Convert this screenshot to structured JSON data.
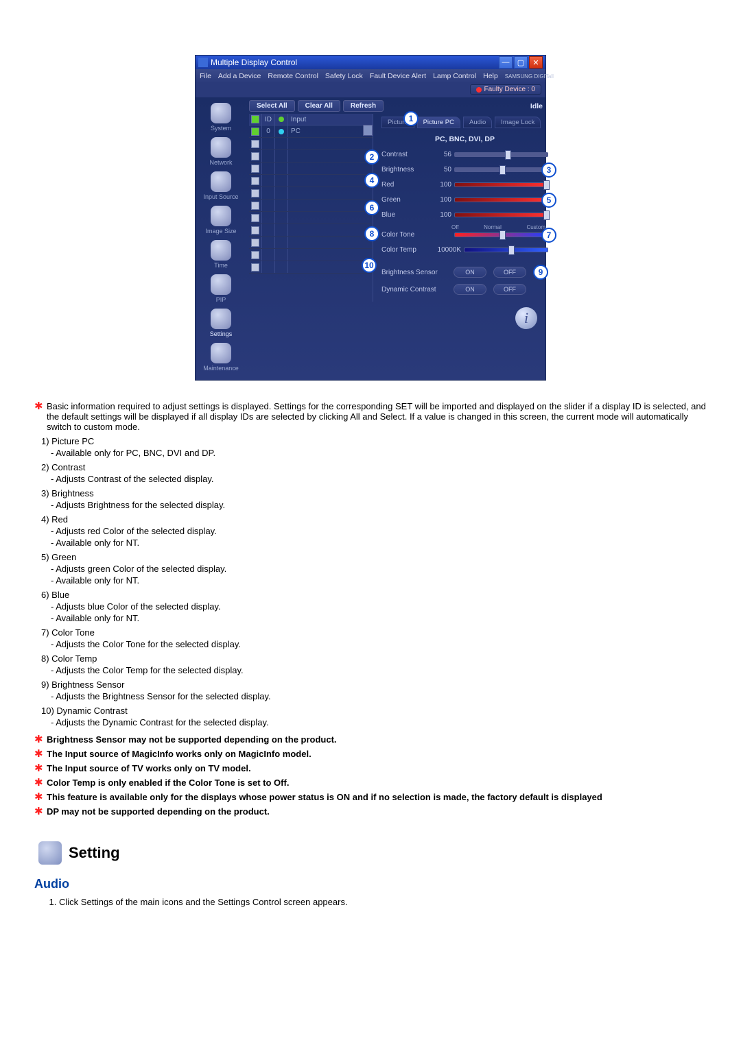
{
  "window": {
    "title": "Multiple Display Control",
    "brand": "SAMSUNG DIGITall"
  },
  "menu": {
    "file": "File",
    "add": "Add a Device",
    "remote": "Remote Control",
    "safety": "Safety Lock",
    "fault": "Fault Device Alert",
    "lamp": "Lamp Control",
    "help": "Help"
  },
  "faulty": "Faulty Device : 0",
  "buttons": {
    "select_all": "Select All",
    "clear_all": "Clear All",
    "refresh": "Refresh",
    "idle": "Idle"
  },
  "sidebar": {
    "items": [
      {
        "label": "System"
      },
      {
        "label": "Network"
      },
      {
        "label": "Input Source"
      },
      {
        "label": "Image Size"
      },
      {
        "label": "Time"
      },
      {
        "label": "PIP"
      },
      {
        "label": "Settings"
      },
      {
        "label": "Maintenance"
      }
    ]
  },
  "table": {
    "head_id": "ID",
    "head_input": "Input",
    "row": {
      "id": "0",
      "input": "PC"
    }
  },
  "tabs": {
    "picture": "Picture",
    "picture_pc": "Picture PC",
    "audio": "Audio",
    "image_lock": "Image Lock"
  },
  "panel": {
    "sub": "PC, BNC, DVI, DP",
    "contrast": {
      "label": "Contrast",
      "value": "56"
    },
    "brightness": {
      "label": "Brightness",
      "value": "50"
    },
    "red": {
      "label": "Red",
      "value": "100"
    },
    "green": {
      "label": "Green",
      "value": "100"
    },
    "blue": {
      "label": "Blue",
      "value": "100"
    },
    "color_tone": {
      "label": "Color Tone",
      "off": "Off",
      "normal": "Normal",
      "custom": "Custom"
    },
    "color_temp": {
      "label": "Color Temp",
      "value": "10000K"
    },
    "b_sensor": {
      "label": "Brightness Sensor",
      "on": "ON",
      "off": "OFF"
    },
    "d_contrast": {
      "label": "Dynamic Contrast",
      "on": "ON",
      "off": "OFF"
    }
  },
  "anno": {
    "n1": "1",
    "n2": "2",
    "n3": "3",
    "n4": "4",
    "n5": "5",
    "n6": "6",
    "n7": "7",
    "n8": "8",
    "n9": "9",
    "n10": "10"
  },
  "doc": {
    "intro": "Basic information required to adjust settings is displayed. Settings for the corresponding SET will be imported and displayed on the slider if a display ID is selected, and the default settings will be displayed if all display IDs are selected by clicking All and Select. If a value is changed in this screen, the current mode will automatically switch to custom mode.",
    "items": [
      {
        "num": "1)",
        "title": "Picture PC",
        "subs": [
          "- Available only for PC, BNC, DVI and DP."
        ]
      },
      {
        "num": "2)",
        "title": "Contrast",
        "subs": [
          "- Adjusts Contrast of the selected display."
        ]
      },
      {
        "num": "3)",
        "title": "Brightness",
        "subs": [
          "- Adjusts Brightness for the selected display."
        ]
      },
      {
        "num": "4)",
        "title": "Red",
        "subs": [
          "- Adjusts red Color of the selected display.",
          "- Available  only for NT."
        ]
      },
      {
        "num": "5)",
        "title": "Green",
        "subs": [
          "- Adjusts green Color of the selected display.",
          "- Available  only for NT."
        ]
      },
      {
        "num": "6)",
        "title": "Blue",
        "subs": [
          "- Adjusts blue Color of the selected display.",
          "- Available  only for NT."
        ]
      },
      {
        "num": "7)",
        "title": "Color Tone",
        "subs": [
          "- Adjusts the Color Tone for the selected display."
        ]
      },
      {
        "num": "8)",
        "title": "Color Temp",
        "subs": [
          "- Adjusts the Color Temp for the selected display."
        ]
      },
      {
        "num": "9)",
        "title": "Brightness Sensor",
        "subs": [
          "- Adjusts the Brightness Sensor for the selected display."
        ]
      },
      {
        "num": "10)",
        "title": "Dynamic Contrast",
        "subs": [
          "- Adjusts the Dynamic Contrast for the selected display."
        ]
      }
    ],
    "notes": [
      "Brightness Sensor may not be supported depending on the product.",
      "The Input source of MagicInfo works only on MagicInfo model.",
      "The Input source of TV works only on TV model.",
      "Color Temp is only enabled if the Color Tone is set to Off.",
      "This feature is available only for the displays whose power status is ON and if no selection is made, the factory default is displayed",
      "DP may not be supported depending on the product."
    ],
    "setting_heading": "Setting",
    "audio_heading": "Audio",
    "step1": "Click Settings of the main icons and the Settings Control screen appears."
  }
}
